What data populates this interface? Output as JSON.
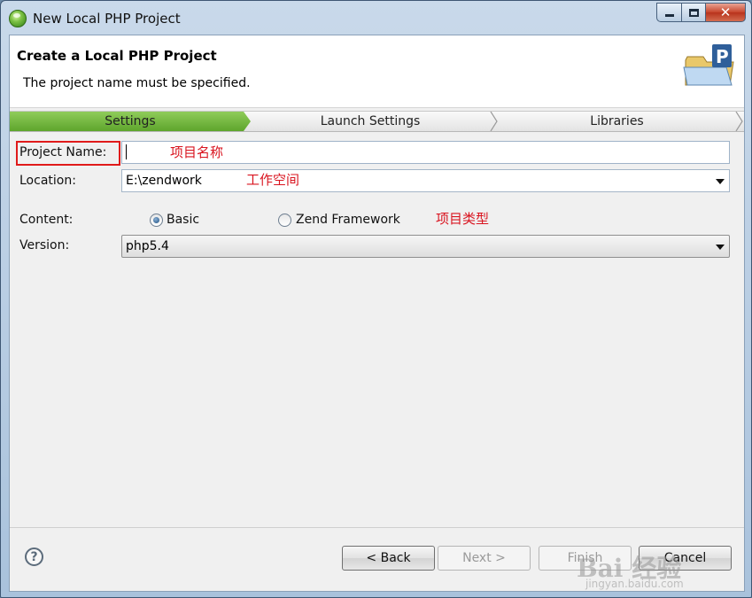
{
  "window": {
    "title": "New Local PHP Project",
    "minimize": "minimize",
    "maximize": "maximize",
    "close": "✕"
  },
  "header": {
    "title": "Create a Local PHP Project",
    "message": "The project name must be specified."
  },
  "steps": [
    {
      "label": "Settings",
      "active": true
    },
    {
      "label": "Launch Settings",
      "active": false
    },
    {
      "label": "Libraries",
      "active": false
    }
  ],
  "form": {
    "project_name_label": "Project Name:",
    "project_name_value": "",
    "location_label": "Location:",
    "location_value": "E:\\zendwork",
    "content_label": "Content:",
    "content_options": [
      {
        "label": "Basic",
        "checked": true
      },
      {
        "label": "Zend Framework",
        "checked": false
      }
    ],
    "version_label": "Version:",
    "version_value": "php5.4"
  },
  "annotations": {
    "project_name": "项目名称",
    "workspace": "工作空间",
    "project_type": "项目类型"
  },
  "buttons": {
    "help": "?",
    "back": "< Back",
    "next": "Next >",
    "finish": "Finish",
    "cancel": "Cancel"
  },
  "watermark": {
    "text": "Bai 经验",
    "sub": "jingyan.baidu.com"
  },
  "colors": {
    "active_step": "#6cb33a",
    "annotation": "#d9141f",
    "highlight_box": "#e01a1a"
  }
}
